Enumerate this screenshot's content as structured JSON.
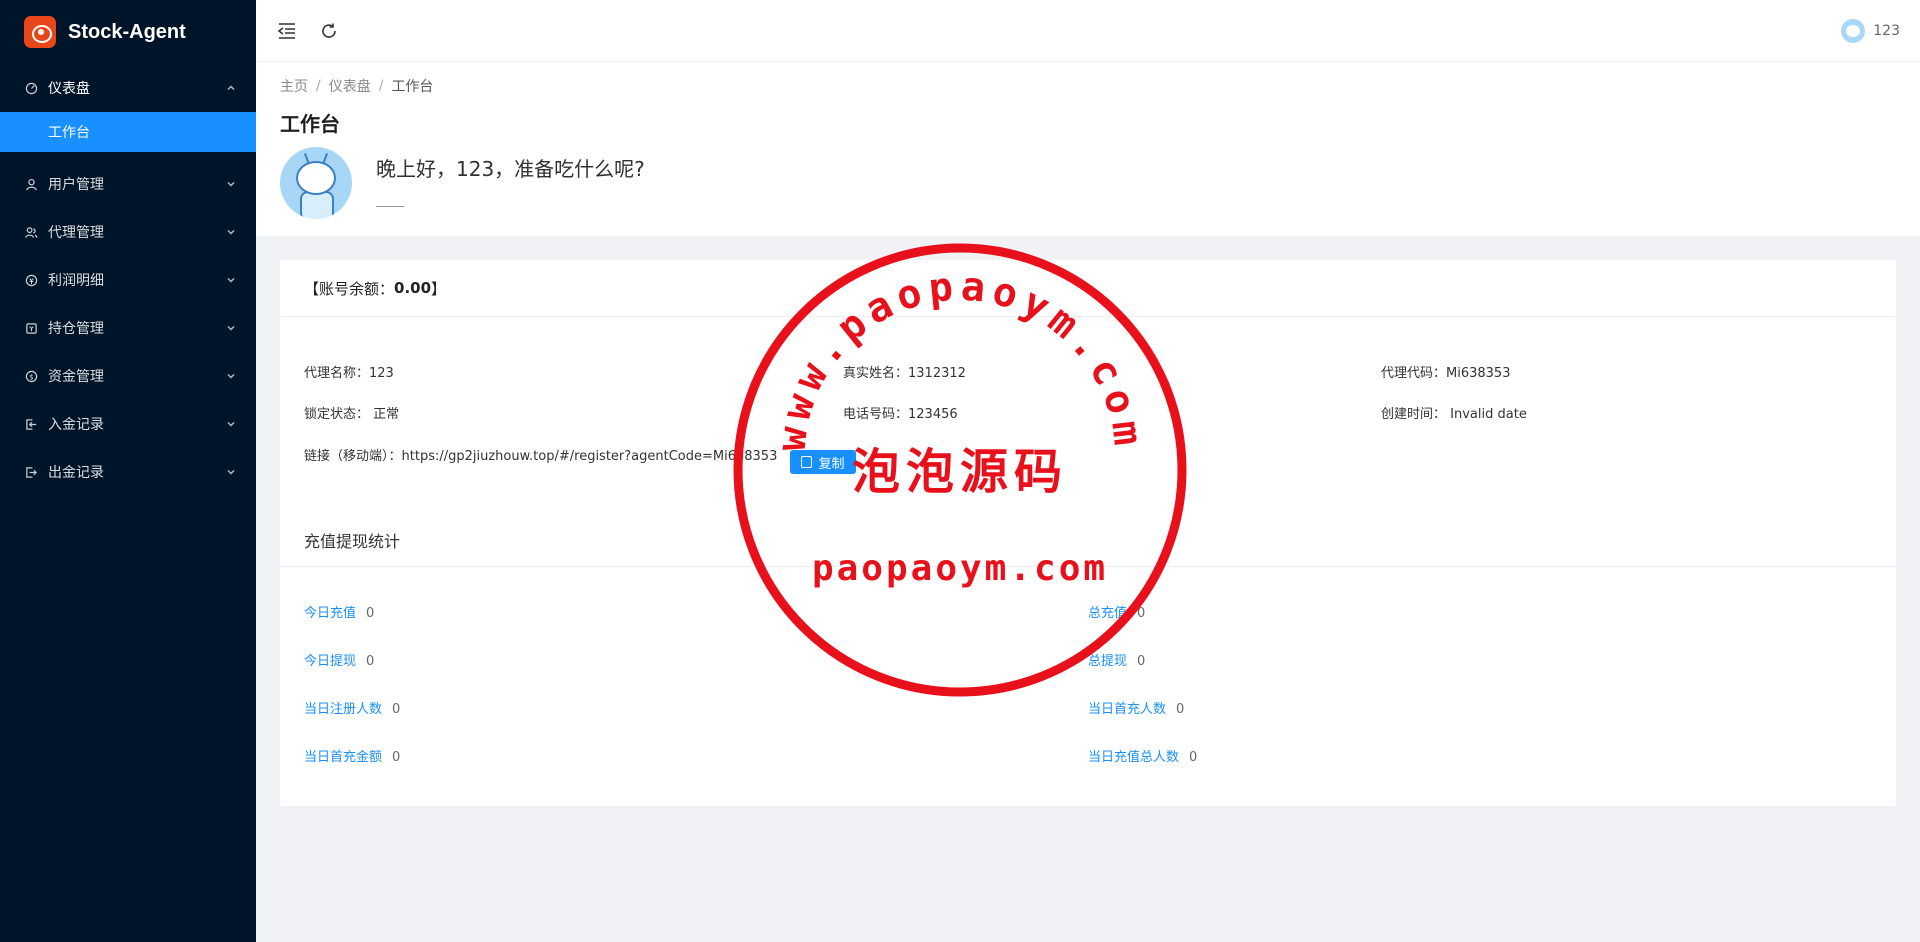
{
  "app": {
    "title": "Stock-Agent"
  },
  "sidebar": {
    "items": [
      {
        "label": "仪表盘",
        "icon": "dashboard-icon",
        "open": true
      },
      {
        "label": "用户管理",
        "icon": "user-icon"
      },
      {
        "label": "代理管理",
        "icon": "team-icon"
      },
      {
        "label": "利润明细",
        "icon": "profit-icon"
      },
      {
        "label": "持仓管理",
        "icon": "position-icon"
      },
      {
        "label": "资金管理",
        "icon": "money-icon"
      },
      {
        "label": "入金记录",
        "icon": "deposit-icon"
      },
      {
        "label": "出金记录",
        "icon": "withdraw-icon"
      }
    ],
    "sub_items": [
      {
        "label": "工作台"
      }
    ]
  },
  "header": {
    "user_name": "123"
  },
  "breadcrumb": [
    "主页",
    "仪表盘",
    "工作台"
  ],
  "page": {
    "title": "工作台",
    "greeting": "晚上好，123，准备吃什么呢?",
    "greet_sub": "——"
  },
  "account": {
    "balance_prefix": "【账号余额：",
    "balance_value": "0.00",
    "balance_suffix": "】"
  },
  "info": {
    "agent_name_label": "代理名称：",
    "agent_name": "123",
    "real_name_label": "真实姓名：",
    "real_name": "1312312",
    "agent_code_label": "代理代码：",
    "agent_code": "Mi638353",
    "lock_label": "锁定状态：",
    "lock_status": "正常",
    "phone_label": "电话号码：",
    "phone": "123456",
    "created_label": "创建时间：",
    "created": "Invalid date",
    "link_label": "链接（移动端）：",
    "link": "https://gp2jiuzhouw.top/#/register?agentCode=Mi638353",
    "copy_label": "复制"
  },
  "stats": {
    "title": "充值提现统计",
    "items": [
      {
        "label": "今日充值",
        "value": "0"
      },
      {
        "label": "总充值",
        "value": "0"
      },
      {
        "label": "今日提现",
        "value": "0"
      },
      {
        "label": "总提现",
        "value": "0"
      },
      {
        "label": "当日注册人数",
        "value": "0"
      },
      {
        "label": "当日首充人数",
        "value": "0"
      },
      {
        "label": "当日首充金额",
        "value": "0"
      },
      {
        "label": "当日充值总人数",
        "value": "0"
      }
    ]
  },
  "watermark": {
    "arc_text": "www.paopaoym.com",
    "cn_text": "泡泡源码",
    "domain_text": "paopaoym.com",
    "color": "#e8101a"
  },
  "colors": {
    "sidebar_bg": "#001529",
    "accent": "#1890ff",
    "page_bg": "#f0f2f5"
  }
}
